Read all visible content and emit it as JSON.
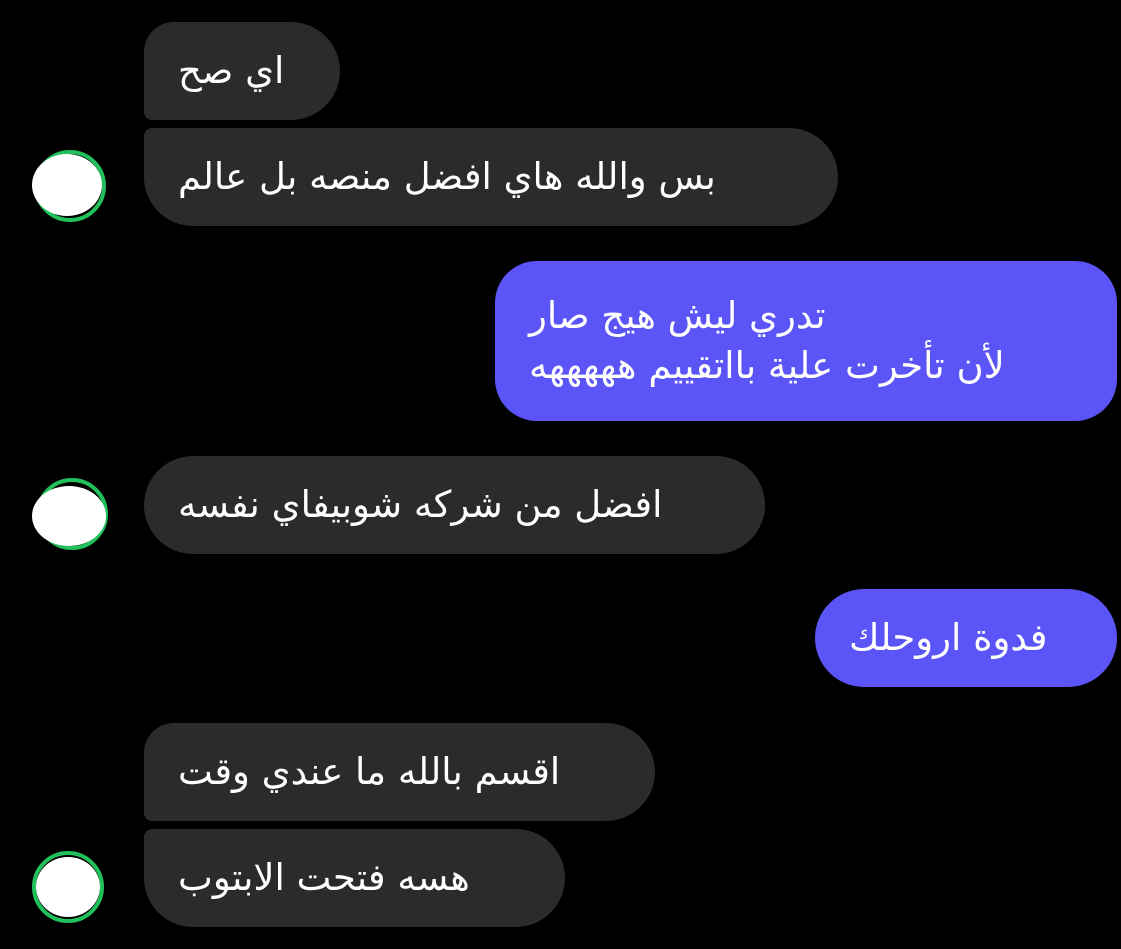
{
  "theme": {
    "background": "#000000",
    "incoming_bubble": "#2b2b2b",
    "outgoing_bubble": "#5b55f7",
    "online_ring": "#21c05a"
  },
  "messages": [
    {
      "direction": "incoming",
      "text": "اي صح"
    },
    {
      "direction": "incoming",
      "text": "بس والله هاي افضل منصه بل عالم"
    },
    {
      "direction": "outgoing",
      "lines": [
        "تدري ليش هيج صار",
        "لأن تأخرت علية بااتقييم هههههه"
      ]
    },
    {
      "direction": "incoming",
      "text": "افضل من شركه شوبيفاي نفسه"
    },
    {
      "direction": "outgoing",
      "text": "فدوة اروحلك"
    },
    {
      "direction": "incoming",
      "text": "اقسم بالله ما عندي وقت"
    },
    {
      "direction": "incoming",
      "text": "هسه فتحت الابتوب"
    }
  ],
  "avatars": [
    {
      "icon": "avatar-icon"
    },
    {
      "icon": "avatar-icon"
    },
    {
      "icon": "avatar-icon"
    }
  ]
}
